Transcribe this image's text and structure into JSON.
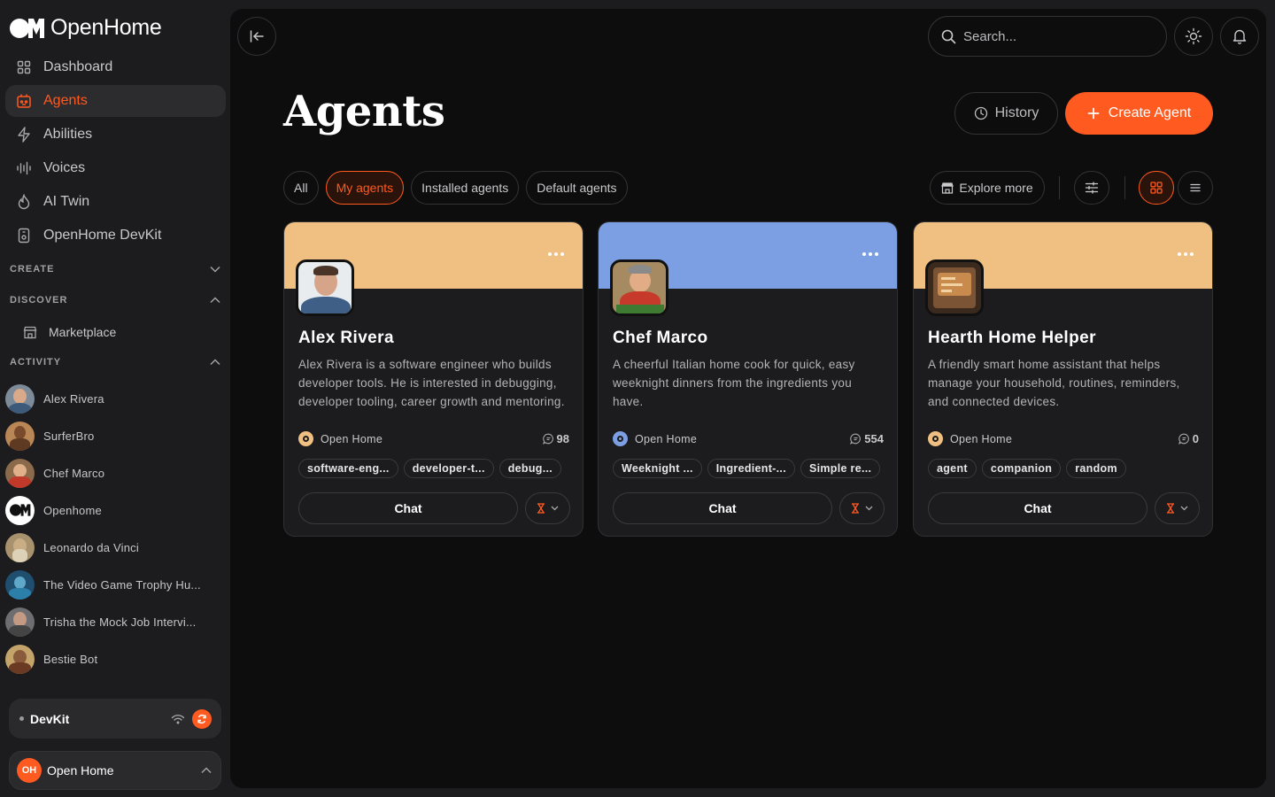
{
  "app": {
    "brand": "OpenHome"
  },
  "sidebar": {
    "nav": [
      {
        "label": "Dashboard",
        "icon": "grid-icon"
      },
      {
        "label": "Agents",
        "icon": "robot-icon",
        "active": true
      },
      {
        "label": "Abilities",
        "icon": "bolt-icon"
      },
      {
        "label": "Voices",
        "icon": "waveform-icon"
      },
      {
        "label": "AI Twin",
        "icon": "flame-icon"
      },
      {
        "label": "OpenHome DevKit",
        "icon": "device-icon"
      }
    ],
    "sections": {
      "create": "CREATE",
      "discover": "DISCOVER",
      "activity": "ACTIVITY"
    },
    "marketplace": "Marketplace",
    "activity": [
      {
        "name": "Alex Rivera"
      },
      {
        "name": "SurferBro"
      },
      {
        "name": "Chef Marco"
      },
      {
        "name": "Openhome"
      },
      {
        "name": "Leonardo da Vinci"
      },
      {
        "name": "The Video Game Trophy Hu..."
      },
      {
        "name": "Trisha the Mock Job Intervi..."
      },
      {
        "name": "Bestie Bot"
      }
    ],
    "devkit": {
      "label": "DevKit"
    },
    "account": {
      "initials": "OH",
      "name": "Open Home"
    }
  },
  "header": {
    "search_placeholder": "Search..."
  },
  "page": {
    "title": "Agents",
    "history_label": "History",
    "create_label": "Create Agent",
    "filters": [
      "All",
      "My agents",
      "Installed agents",
      "Default agents"
    ],
    "active_filter": "My agents",
    "explore_label": "Explore more"
  },
  "colors": {
    "accent": "#ff5a1f",
    "banner_peach": "#efc081",
    "banner_blue": "#7c9ee2"
  },
  "cards": [
    {
      "name": "Alex Rivera",
      "description": "Alex Rivera is a software engineer who builds developer tools. He is interested in debugging, developer tooling, career growth and mentoring.",
      "owner": "Open Home",
      "owner_color": "#efc081",
      "messages": "98",
      "tags": [
        "software-eng...",
        "developer-t...",
        "debug..."
      ],
      "chat_label": "Chat",
      "banner": "#efc081"
    },
    {
      "name": "Chef Marco",
      "description": "A cheerful Italian home cook for quick, easy weeknight dinners from the ingredients you have.",
      "owner": "Open Home",
      "owner_color": "#7c9ee2",
      "messages": "554",
      "tags": [
        "Weeknight ...",
        "Ingredient-...",
        "Simple re..."
      ],
      "chat_label": "Chat",
      "banner": "#7c9ee2"
    },
    {
      "name": "Hearth Home Helper",
      "description": "A friendly smart home assistant that helps manage your household, routines, reminders, and connected devices.",
      "owner": "Open Home",
      "owner_color": "#efc081",
      "messages": "0",
      "tags": [
        "agent",
        "companion",
        "random"
      ],
      "chat_label": "Chat",
      "banner": "#efc081"
    }
  ]
}
